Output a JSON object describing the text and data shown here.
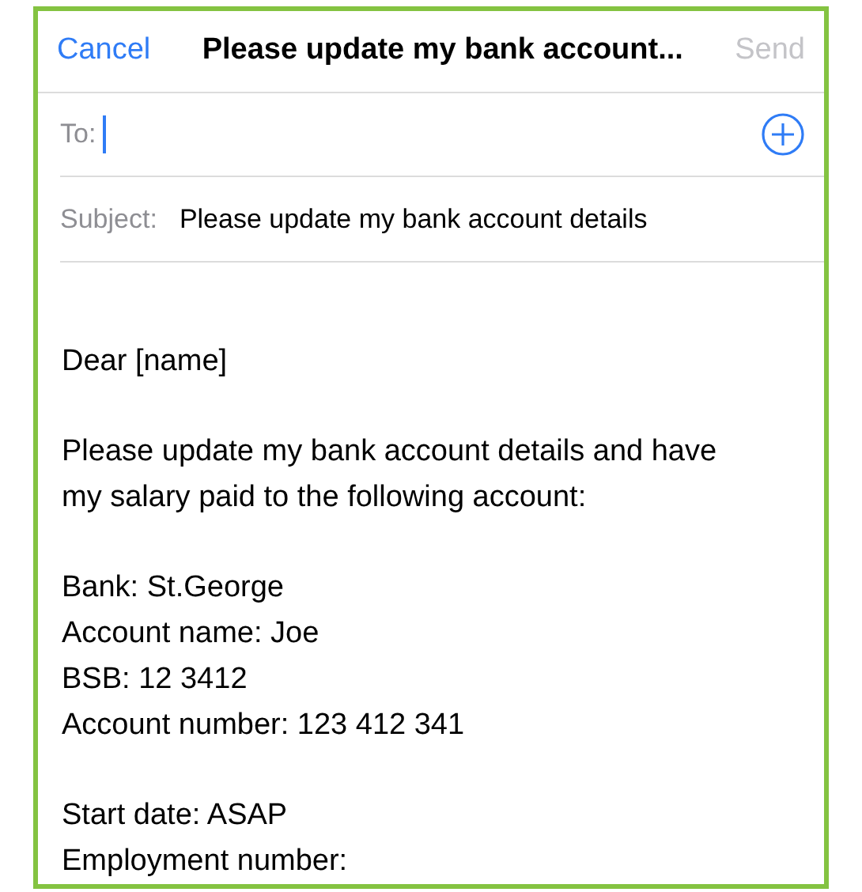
{
  "nav": {
    "cancel": "Cancel",
    "title": "Please update my bank account...",
    "send": "Send",
    "send_disabled": true
  },
  "to": {
    "label": "To:",
    "focused": true
  },
  "subject": {
    "label": "Subject:",
    "value": "Please update my bank account details"
  },
  "body": [
    {
      "lines": [
        "Dear [name]"
      ]
    },
    {
      "lines": [
        "Please update my bank account details and have",
        "my salary paid to the following account:"
      ]
    },
    {
      "lines": [
        "Bank: St.George",
        "Account name: Joe",
        "BSB: 12 3412",
        "Account number: 123 412 341"
      ]
    },
    {
      "lines": [
        "Start date: ASAP",
        "Employment number:"
      ]
    }
  ]
}
